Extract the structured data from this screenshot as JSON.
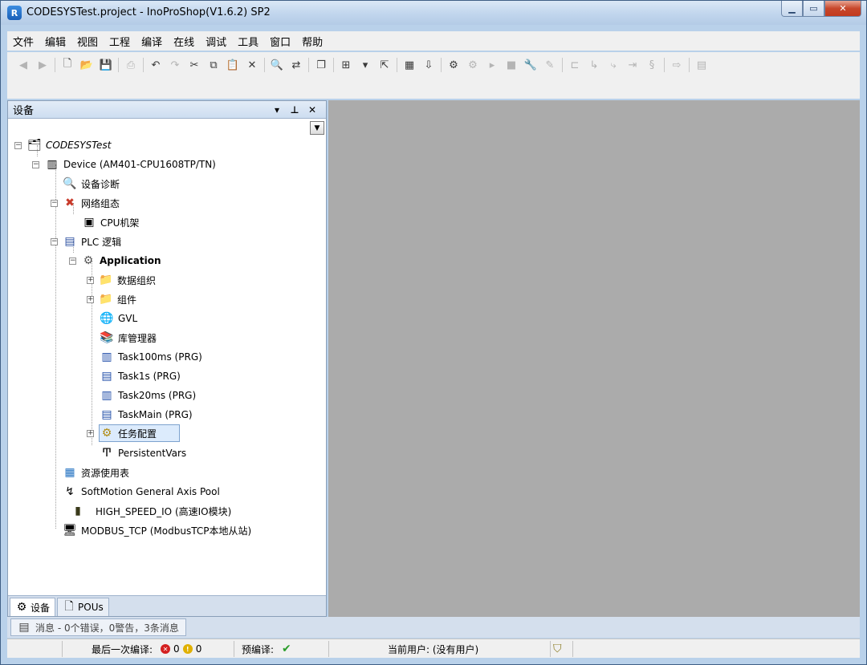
{
  "window": {
    "title": "CODESYSTest.project - InoProShop(V1.6.2) SP2",
    "minimize": "▁",
    "maximize": "▭",
    "close": "✕"
  },
  "menu": [
    "文件",
    "编辑",
    "视图",
    "工程",
    "编译",
    "在线",
    "调试",
    "工具",
    "窗口",
    "帮助"
  ],
  "panel": {
    "title": "设备",
    "dropdown": "▾",
    "pin": "⊥",
    "close": "✕"
  },
  "tree": {
    "root": "CODESYSTest",
    "device": "Device (AM401-CPU1608TP/TN)",
    "diag": "设备诊断",
    "network": "网络组态",
    "cpu_rack": "CPU机架",
    "plc_logic": "PLC 逻辑",
    "application": "Application",
    "data_org": "数据组织",
    "components": "组件",
    "gvl": "GVL",
    "lib_manager": "库管理器",
    "task100ms": "Task100ms (PRG)",
    "task1s": "Task1s (PRG)",
    "task20ms": "Task20ms (PRG)",
    "taskmain": "TaskMain (PRG)",
    "task_config": "任务配置",
    "persistent": "PersistentVars",
    "resource": "资源使用表",
    "softmotion": "SoftMotion General Axis Pool",
    "high_speed": "HIGH_SPEED_IO (高速IO模块)",
    "modbus": "MODBUS_TCP (ModbusTCP本地从站)"
  },
  "panel_tabs": [
    "设备",
    "POUs"
  ],
  "messages": "消息 - 0个错误，0警告，3条消息",
  "status": {
    "last_compile": "最后一次编译:",
    "errors": "0",
    "warnings": "0",
    "precompile": "预编译:",
    "precompile_ok": "✔",
    "current_user": "当前用户: (没有用户)"
  },
  "colors": {
    "accent": "#1a5fb8",
    "editor_bg": "#ababab",
    "selection": "#dcebfc",
    "error": "#d42020",
    "warning": "#e0b000",
    "ok": "#2a9d2a"
  }
}
